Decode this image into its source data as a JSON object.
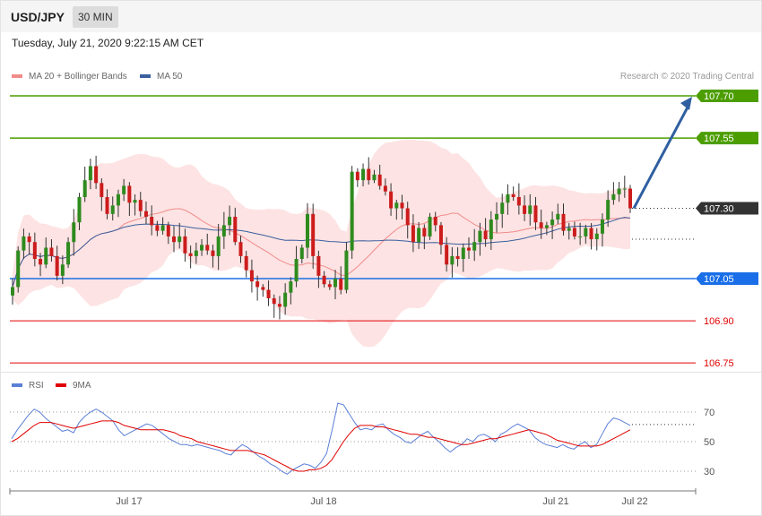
{
  "header": {
    "symbol": "USD/JPY",
    "timeframe": "30 MIN"
  },
  "timestamp": "Tuesday, July 21, 2020 9:22:15 AM CET",
  "price_legend": [
    {
      "label": "MA 20 + Bollinger Bands",
      "color": "#f28b8b"
    },
    {
      "label": "MA 50",
      "color": "#3a5f9e"
    }
  ],
  "credit": "Research © 2020 Trading Central",
  "rsi_legend": [
    {
      "label": "RSI",
      "color": "#5b7fd6"
    },
    {
      "label": "9MA",
      "color": "#e00000"
    }
  ],
  "chart_data": [
    {
      "type": "candlestick",
      "symbol": "USD/JPY",
      "timeframe": "30 MIN",
      "ylim": [
        106.7,
        107.8
      ],
      "series": [
        "MA 20 + Bollinger Bands",
        "MA 50"
      ],
      "levels": [
        {
          "label": "107.70",
          "value": 107.7,
          "role": "resistance",
          "color": "#4c9e00"
        },
        {
          "label": "107.55",
          "value": 107.55,
          "role": "resistance",
          "color": "#4c9e00"
        },
        {
          "label": "107.30",
          "value": 107.3,
          "role": "last price",
          "color": "#333333"
        },
        {
          "label": "107.05",
          "value": 107.05,
          "role": "pivot",
          "color": "#1a6fe8"
        },
        {
          "label": "106.90",
          "value": 106.9,
          "role": "support",
          "color": "#e00000"
        },
        {
          "label": "106.75",
          "value": 106.75,
          "role": "support",
          "color": "#e00000"
        }
      ],
      "projection": {
        "from": 107.3,
        "to": 107.7,
        "color": "#2f5fa0"
      },
      "x_tick_labels": [
        "Jul 17",
        "Jul 18",
        "Jul 21",
        "Jul 22"
      ],
      "close": [
        107.02,
        107.15,
        107.2,
        107.18,
        107.12,
        107.1,
        107.16,
        107.13,
        107.06,
        107.1,
        107.18,
        107.25,
        107.34,
        107.4,
        107.45,
        107.39,
        107.34,
        107.28,
        107.31,
        107.35,
        107.38,
        107.32,
        107.33,
        107.29,
        107.27,
        107.24,
        107.22,
        107.24,
        107.2,
        107.18,
        107.2,
        107.14,
        107.13,
        107.15,
        107.17,
        107.15,
        107.13,
        107.2,
        107.24,
        107.27,
        107.18,
        107.13,
        107.08,
        107.04,
        107.02,
        107.01,
        106.98,
        106.96,
        106.95,
        107.0,
        107.04,
        107.12,
        107.16,
        107.28,
        107.13,
        107.06,
        107.03,
        107.02,
        107.05,
        107.01,
        107.15,
        107.43,
        107.4,
        107.44,
        107.4,
        107.42,
        107.38,
        107.36,
        107.3,
        107.32,
        107.3,
        107.24,
        107.18,
        107.23,
        107.2,
        107.27,
        107.24,
        107.17,
        107.1,
        107.13,
        107.12,
        107.16,
        107.15,
        107.18,
        107.22,
        107.19,
        107.26,
        107.28,
        107.32,
        107.35,
        107.34,
        107.31,
        107.28,
        107.31,
        107.25,
        107.23,
        107.24,
        107.26,
        107.28,
        107.22,
        107.23,
        107.2,
        107.2,
        107.23,
        107.19,
        107.21,
        107.26,
        107.33,
        107.35,
        107.37,
        107.37,
        107.3
      ]
    },
    {
      "type": "line",
      "title": "RSI",
      "ylim": [
        20,
        80
      ],
      "y_ticks": [
        30,
        50,
        70
      ],
      "series": [
        {
          "name": "RSI",
          "values": [
            52,
            58,
            63,
            68,
            72,
            70,
            66,
            63,
            60,
            57,
            58,
            56,
            63,
            67,
            70,
            72,
            70,
            67,
            64,
            58,
            54,
            56,
            58,
            60,
            62,
            61,
            58,
            55,
            52,
            50,
            48,
            48,
            47,
            48,
            47,
            46,
            45,
            44,
            42,
            41,
            45,
            48,
            46,
            43,
            40,
            38,
            35,
            33,
            30,
            28,
            31,
            33,
            35,
            34,
            32,
            36,
            42,
            58,
            76,
            75,
            69,
            63,
            58,
            59,
            58,
            61,
            62,
            58,
            55,
            53,
            50,
            49,
            52,
            55,
            57,
            53,
            50,
            46,
            43,
            46,
            48,
            52,
            50,
            54,
            55,
            53,
            50,
            55,
            57,
            60,
            62,
            60,
            58,
            53,
            50,
            48,
            47,
            46,
            48,
            46,
            45,
            48,
            50,
            46,
            48,
            55,
            62,
            66,
            65,
            63,
            61
          ]
        },
        {
          "name": "9MA",
          "values": [
            50,
            52,
            55,
            58,
            61,
            63,
            63,
            63,
            62,
            61,
            60,
            59,
            60,
            61,
            62,
            63,
            64,
            64,
            64,
            63,
            61,
            60,
            59,
            58,
            58,
            58,
            58,
            58,
            57,
            56,
            54,
            53,
            52,
            50,
            49,
            48,
            47,
            46,
            45,
            44,
            44,
            44,
            44,
            43,
            42,
            41,
            39,
            37,
            35,
            33,
            31,
            30,
            30,
            31,
            31,
            32,
            34,
            38,
            44,
            50,
            55,
            59,
            61,
            61,
            61,
            60,
            60,
            59,
            58,
            57,
            56,
            55,
            55,
            54,
            53,
            53,
            52,
            51,
            50,
            49,
            48,
            48,
            49,
            50,
            51,
            52,
            52,
            53,
            54,
            55,
            56,
            57,
            58,
            57,
            56,
            55,
            53,
            51,
            50,
            49,
            48,
            47,
            47,
            47,
            47,
            48,
            50,
            52,
            54,
            56,
            58
          ]
        }
      ]
    }
  ]
}
